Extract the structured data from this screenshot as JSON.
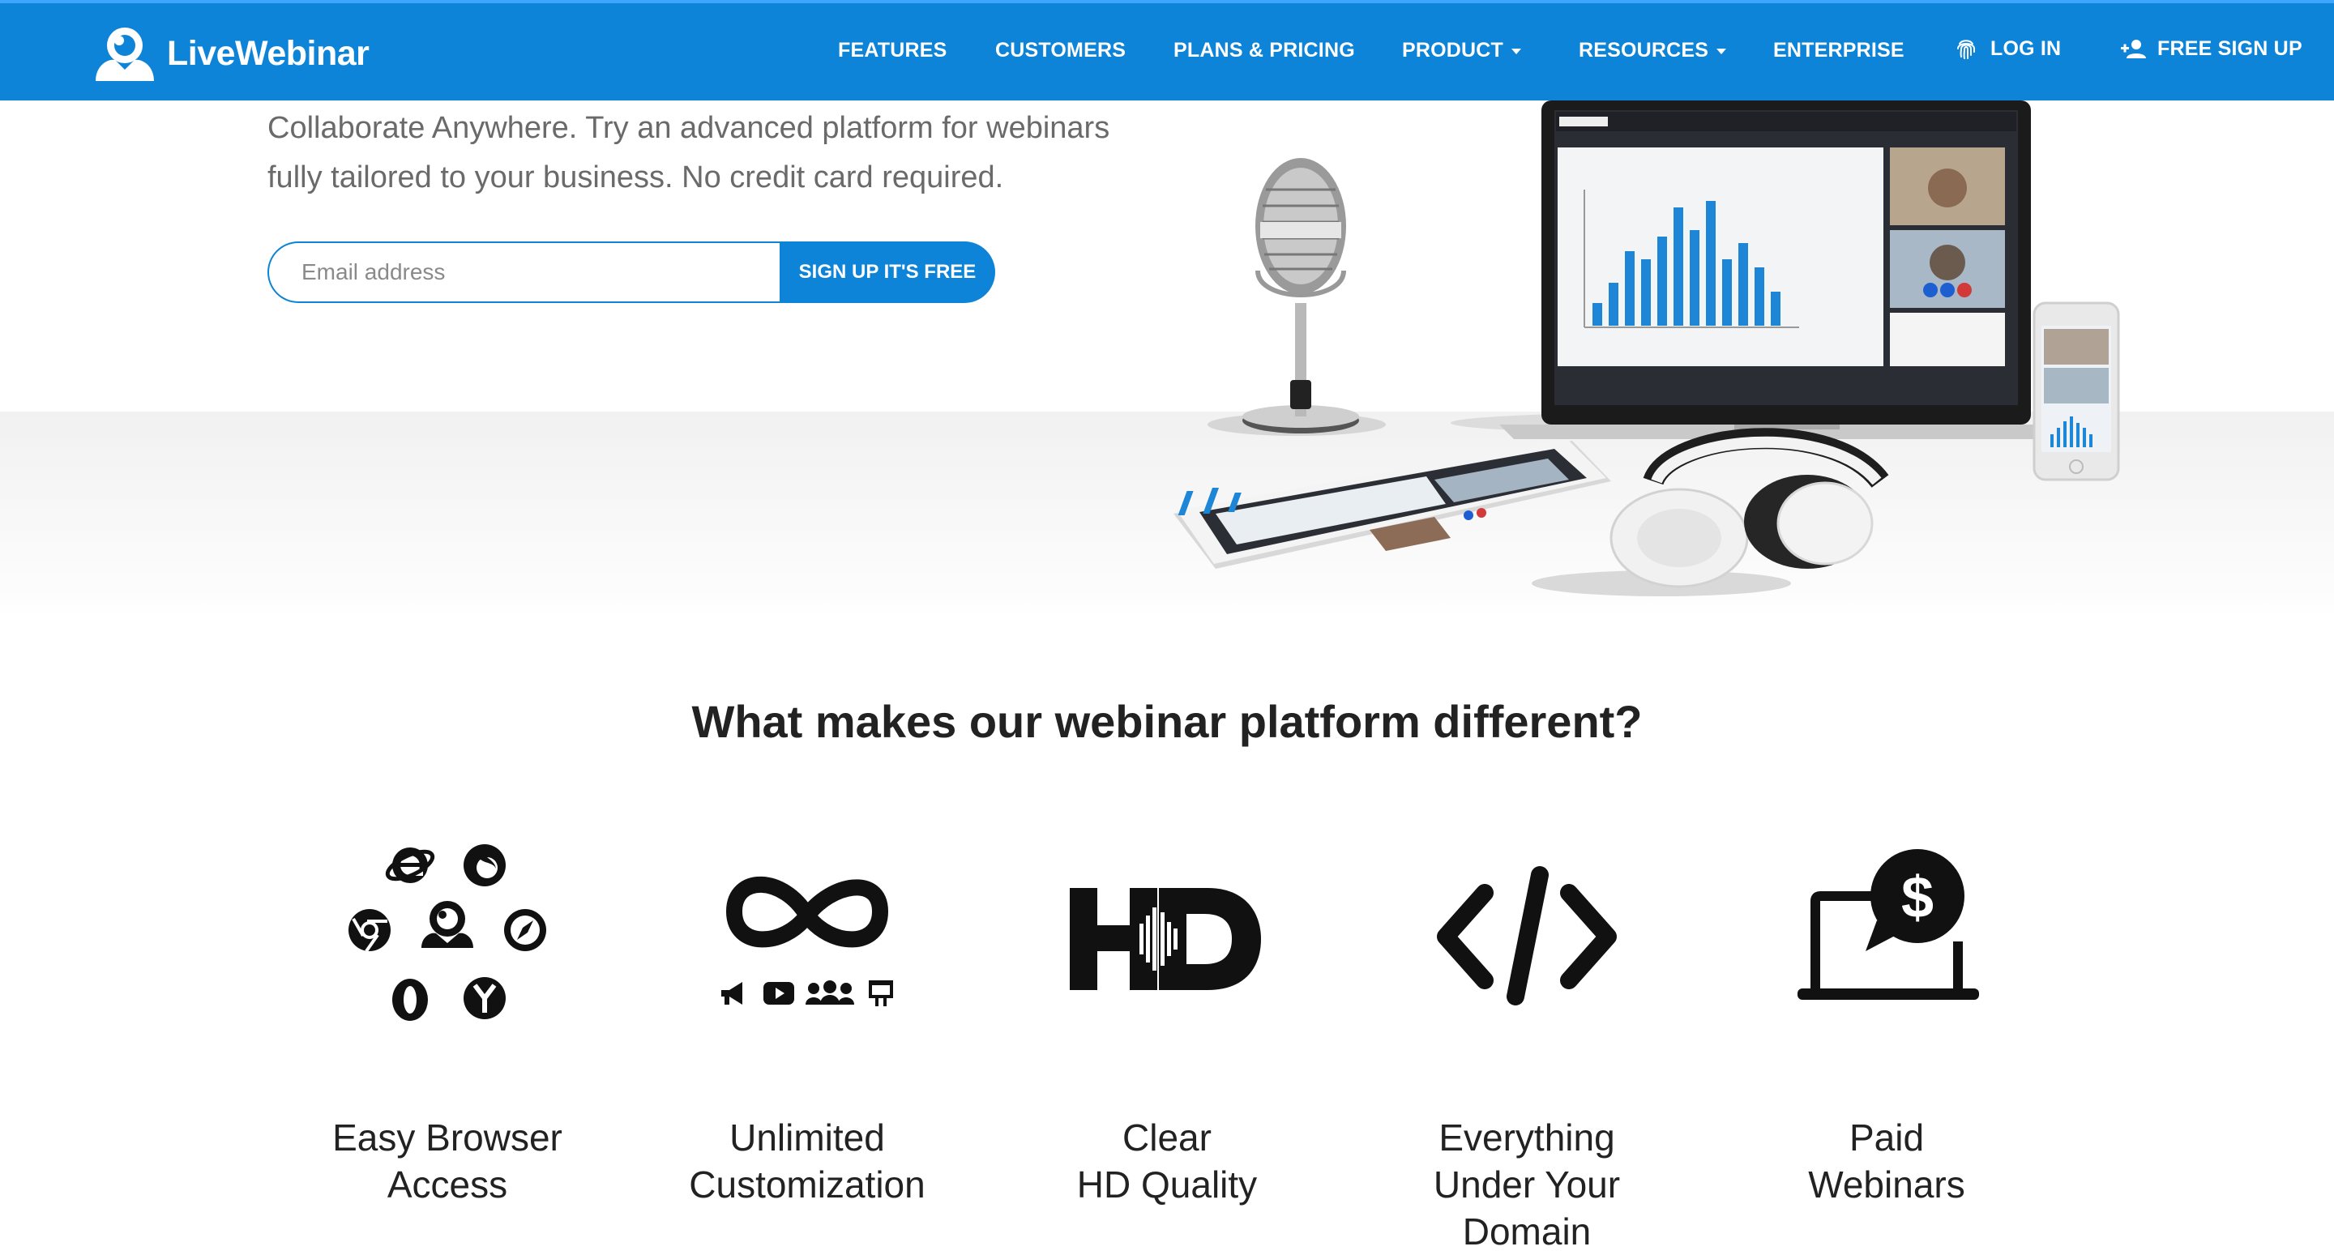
{
  "brand": {
    "name": "LiveWebinar",
    "accent_color": "#0d84d8"
  },
  "nav": {
    "items": [
      {
        "label": "FEATURES"
      },
      {
        "label": "CUSTOMERS"
      },
      {
        "label": "PLANS & PRICING"
      },
      {
        "label": "PRODUCT",
        "dropdown": true
      },
      {
        "label": "RESOURCES",
        "dropdown": true
      },
      {
        "label": "ENTERPRISE"
      },
      {
        "label": "LOG IN",
        "icon": "fingerprint-icon"
      },
      {
        "label": "FREE SIGN UP",
        "icon": "add-user-icon"
      }
    ]
  },
  "hero": {
    "text": "Collaborate Anywhere. Try an advanced platform for webinars fully tailored to your business. No credit card required.",
    "line1": "Collaborate Anywhere. Try an advanced platform for webinars",
    "line2": "fully tailored to your business. No credit card required.",
    "email_placeholder": "Email address",
    "signup_label": "SIGN UP IT'S FREE"
  },
  "features": {
    "title": "What makes our webinar platform different?",
    "items": [
      {
        "line1": "Easy Browser",
        "line2": "Access",
        "line3": "",
        "icon": "browsers-icon"
      },
      {
        "line1": "Unlimited",
        "line2": "Customization",
        "line3": "",
        "icon": "infinity-icon"
      },
      {
        "line1": "Clear",
        "line2": "HD Quality",
        "line3": "",
        "icon": "hd-icon"
      },
      {
        "line1": "Everything",
        "line2": "Under Your",
        "line3": "Domain",
        "icon": "code-icon"
      },
      {
        "line1": "Paid",
        "line2": "Webinars",
        "line3": "",
        "icon": "paid-laptop-icon"
      }
    ]
  }
}
